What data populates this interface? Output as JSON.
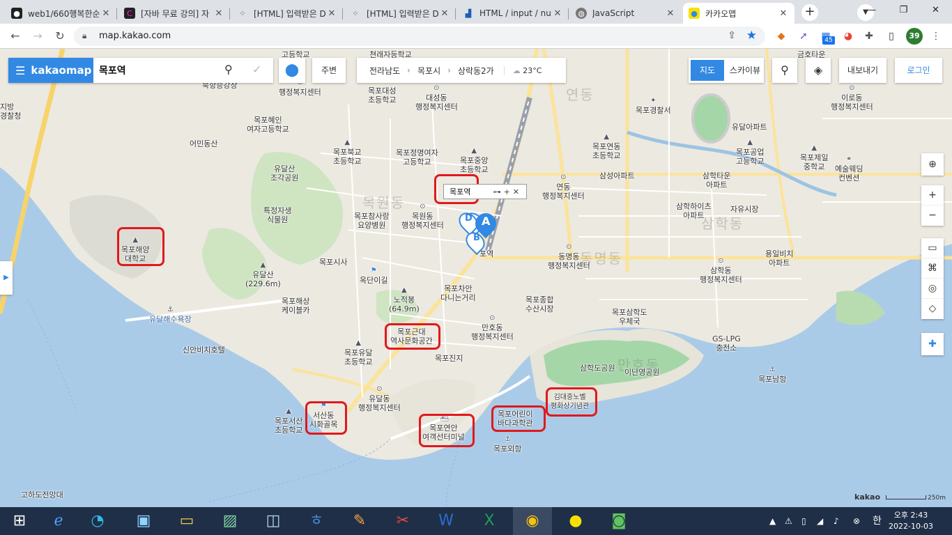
{
  "browser": {
    "tabs": [
      {
        "title": "web1/660행복한순",
        "icon": "github-icon"
      },
      {
        "title": "[자바 무료 강의] 자",
        "icon": "cl-icon"
      },
      {
        "title": "[HTML] 입력받은 D",
        "icon": "dots-icon"
      },
      {
        "title": "[HTML] 입력받은 D",
        "icon": "dots-icon"
      },
      {
        "title": "HTML / input / nur",
        "icon": "chart-icon"
      },
      {
        "title": "JavaScript",
        "icon": "globe-icon"
      },
      {
        "title": "카카오맵",
        "icon": "kakao-pin-icon"
      }
    ],
    "url": "map.kakao.com",
    "profile_badge": "39",
    "ext_badge": "45"
  },
  "map_ui": {
    "brand": "kakaomap",
    "search_value": "목포역",
    "nearby_label": "주변",
    "breadcrumb": [
      "전라남도",
      "목포시",
      "상락동2가"
    ],
    "temperature": "23°C",
    "map_mode": "지도",
    "skyview_mode": "스카이뷰",
    "export_label": "내보내기",
    "login_label": "로그인",
    "popup_name": "목포역",
    "scale_brand": "kakao",
    "scale_distance": "250m",
    "accent_color": "#3189e3"
  },
  "map_labels": {
    "l1": "고등학교",
    "l2": "쳔래자등학교",
    "l3": "목포홍일",
    "l4": "북항승강장",
    "l5": "지방",
    "l6": "경찰청",
    "l7": "목포대성",
    "l8": "초등학교",
    "l9": "대성동",
    "l10": "행정복지센터",
    "l11": "목포혜인",
    "l12": "여자고등학교",
    "l13": "어민동산",
    "l14": "목포북교",
    "l15": "초등학교",
    "l16": "목포정명여자",
    "l17": "고등학교",
    "l18": "목포중앙",
    "l19": "초등학교",
    "l20": "유달산",
    "l21": "조각공원",
    "l22": "특정자생",
    "l23": "식물원",
    "l24": "목포참사랑",
    "l25": "요양병원",
    "l26": "목원동",
    "l27": "행정복지센터",
    "l28": "목포시사",
    "l29": "유달산",
    "l30": "(229.6m)",
    "l31": "목포해양",
    "l32": "대학교",
    "l33": "유달해수욕장",
    "l34": "목포해상",
    "l35": "케이블카",
    "l36": "신안비치호텔",
    "l37": "목포유달",
    "l38": "초등학교",
    "l39": "노적봉",
    "l40": "(64.9m)",
    "l41": "목포근대",
    "l42": "역사문화공간",
    "l43": "목포진지",
    "l44": "유달동",
    "l45": "행정복지센터",
    "l46": "서산동",
    "l47": "시화골목",
    "l48": "목포서산",
    "l49": "초등학교",
    "l50": "목포연안",
    "l51": "여객선터미널",
    "l52": "목포어린이",
    "l53": "바다과학관",
    "l54": "김대중노벨",
    "l55": "평화상기념관",
    "l56": "목포외항",
    "l57": "삼학도공원",
    "l58": "이난영공원",
    "l59": "목포남항",
    "l60": "GS-LPG",
    "l61": "충전소",
    "l62": "목포삼학도",
    "l63": "우체국",
    "l64": "목포종합",
    "l65": "수산시장",
    "l66": "만호동",
    "l67": "행정복지센터",
    "l68": "목포차안",
    "l69": "다니는거리",
    "l70": "옥단이길",
    "l71": "동명동",
    "l72": "행정복지센터",
    "l73": "삼학동",
    "l74": "행정복지센터",
    "l75": "용일비치",
    "l76": "아파트",
    "l77": "삼학하이츠",
    "l78": "아파트",
    "l79": "자유시장",
    "l80": "삼학타운",
    "l81": "아파트",
    "l82": "연동",
    "l83": "행정복지센터",
    "l84": "삼성아파트",
    "l85": "목포연동",
    "l86": "초등학교",
    "l87": "목포경찰서",
    "l88": "유달아파트",
    "l89": "목포공업",
    "l90": "고등학교",
    "l91": "목포제일",
    "l92": "중학교",
    "l93": "예술웨딩",
    "l94": "컨벤션",
    "l95": "이로동",
    "l96": "행정복지센터",
    "l97": "금호타운",
    "l98": "고하도전망대",
    "l99": "포역",
    "big1": "목원동",
    "big2": "연동",
    "big3": "삼학동",
    "big4": "동명동",
    "big5": "만호동"
  },
  "taskbar": {
    "time": "오후 2:43",
    "date": "2022-10-03",
    "ime": "한"
  }
}
